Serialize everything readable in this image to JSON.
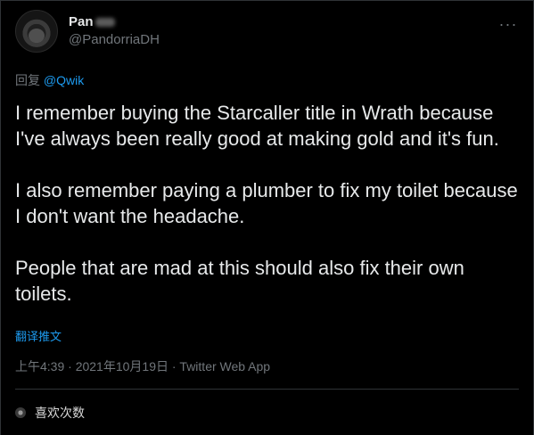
{
  "author": {
    "display_name": "Pan",
    "handle": "@PandorriaDH"
  },
  "reply": {
    "prefix": "回复",
    "mention": "@Qwik"
  },
  "tweet": {
    "paragraphs": [
      "I remember buying the Starcaller title in Wrath because I've always been really good at making gold and it's fun.",
      "I also remember paying a plumber to fix my toilet because I don't want the headache.",
      "People that are mad at this should also fix their own toilets."
    ],
    "translate_label": "翻译推文",
    "timestamp": "上午4:39 · 2021年10月19日 · Twitter Web App"
  },
  "stats": {
    "likes_label": "喜欢次数"
  },
  "icons": {
    "more": "more-icon"
  }
}
